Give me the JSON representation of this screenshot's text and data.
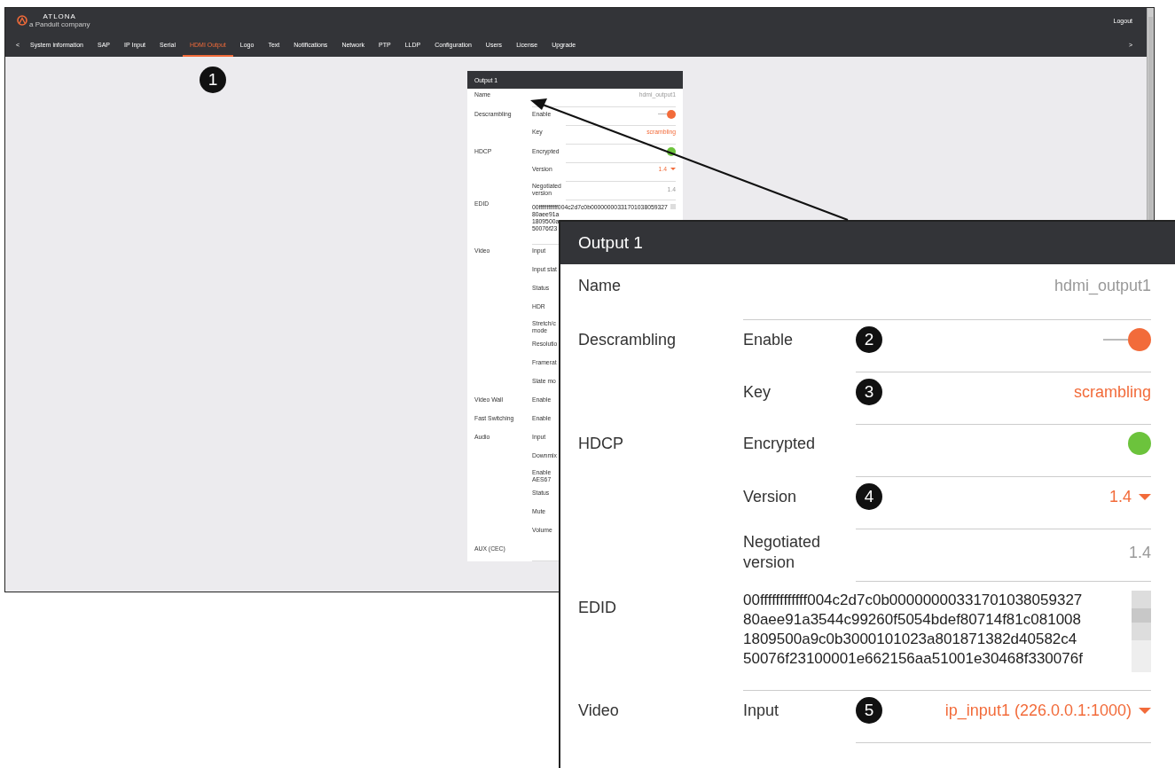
{
  "screen": {
    "logo": {
      "name": "ATLONA",
      "tagline": "a Panduit company"
    },
    "logout": "Logout",
    "nav": {
      "prev": "<",
      "next": ">",
      "tabs": [
        {
          "label": "System information",
          "selected": false
        },
        {
          "label": "SAP",
          "selected": false
        },
        {
          "label": "IP Input",
          "selected": false
        },
        {
          "label": "Serial",
          "selected": false
        },
        {
          "label": "HDMI Output",
          "selected": true
        },
        {
          "label": "Logo",
          "selected": false
        },
        {
          "label": "Text",
          "selected": false
        },
        {
          "label": "Notifications",
          "selected": false
        },
        {
          "label": "Network",
          "selected": false
        },
        {
          "label": "PTP",
          "selected": false
        },
        {
          "label": "LLDP",
          "selected": false
        },
        {
          "label": "Configuration",
          "selected": false
        },
        {
          "label": "Users",
          "selected": false
        },
        {
          "label": "License",
          "selected": false
        },
        {
          "label": "Upgrade",
          "selected": false
        }
      ]
    },
    "panel": {
      "title": "Output 1",
      "rows": [
        {
          "group": "Name",
          "kind": "text",
          "value": "hdmi_output1"
        },
        {
          "group": "Descrambling",
          "label": "Enable",
          "kind": "toggle",
          "on": true
        },
        {
          "label": "Key",
          "kind": "link",
          "value": "scrambling"
        },
        {
          "group": "HDCP",
          "label": "Encrypted",
          "kind": "status",
          "on": true
        },
        {
          "label": "Version",
          "kind": "select",
          "value": "1.4"
        },
        {
          "label": "Negotiated version",
          "kind": "text",
          "value": "1.4"
        },
        {
          "group": "EDID",
          "kind": "edid",
          "lines": [
            "00ffffffffffff004c2d7c0b00000000331701038059327",
            "80aee91a",
            "1809500a",
            "50076f23"
          ]
        },
        {
          "group": "Video",
          "label": "Input"
        },
        {
          "label": "Input stat"
        },
        {
          "label": "Status"
        },
        {
          "label": "HDR"
        },
        {
          "label": "Stretch/c mode"
        },
        {
          "label": "Resolutio"
        },
        {
          "label": "Framerat"
        },
        {
          "label": "Slate mo"
        },
        {
          "group": "Video Wall",
          "label": "Enable"
        },
        {
          "group": "Fast Switching",
          "label": "Enable"
        },
        {
          "group": "Audio",
          "label": "Input"
        },
        {
          "label": "Downmix"
        },
        {
          "label": "Enable AES67"
        },
        {
          "label": "Status"
        },
        {
          "label": "Mute"
        },
        {
          "label": "Volume"
        },
        {
          "group": "AUX (CEC)"
        }
      ]
    }
  },
  "tab_badge": "1",
  "callout": {
    "title": "Output 1",
    "rows": [
      {
        "group": "Name",
        "kind": "text",
        "value": "hdmi_output1"
      },
      {
        "group": "Descrambling",
        "label": "Enable",
        "badge": "2",
        "kind": "toggle",
        "on": true
      },
      {
        "label": "Key",
        "badge": "3",
        "kind": "link",
        "value": "scrambling"
      },
      {
        "group": "HDCP",
        "label": "Encrypted",
        "kind": "status",
        "on": true
      },
      {
        "label": "Version",
        "badge": "4",
        "kind": "select",
        "value": "1.4"
      },
      {
        "label": "Negotiated version",
        "kind": "text",
        "value": "1.4"
      },
      {
        "group": "EDID",
        "kind": "edid",
        "lines": [
          "00ffffffffffff004c2d7c0b00000000331701038059327",
          "80aee91a3544c99260f5054bdef80714f81c081008",
          "1809500a9c0b3000101023a801871382d40582c4",
          "50076f23100001e662156aa51001e30468f330076f"
        ]
      },
      {
        "group": "Video",
        "label": "Input",
        "badge": "5",
        "kind": "select",
        "value": "ip_input1 (226.0.0.1:1000)"
      }
    ]
  }
}
